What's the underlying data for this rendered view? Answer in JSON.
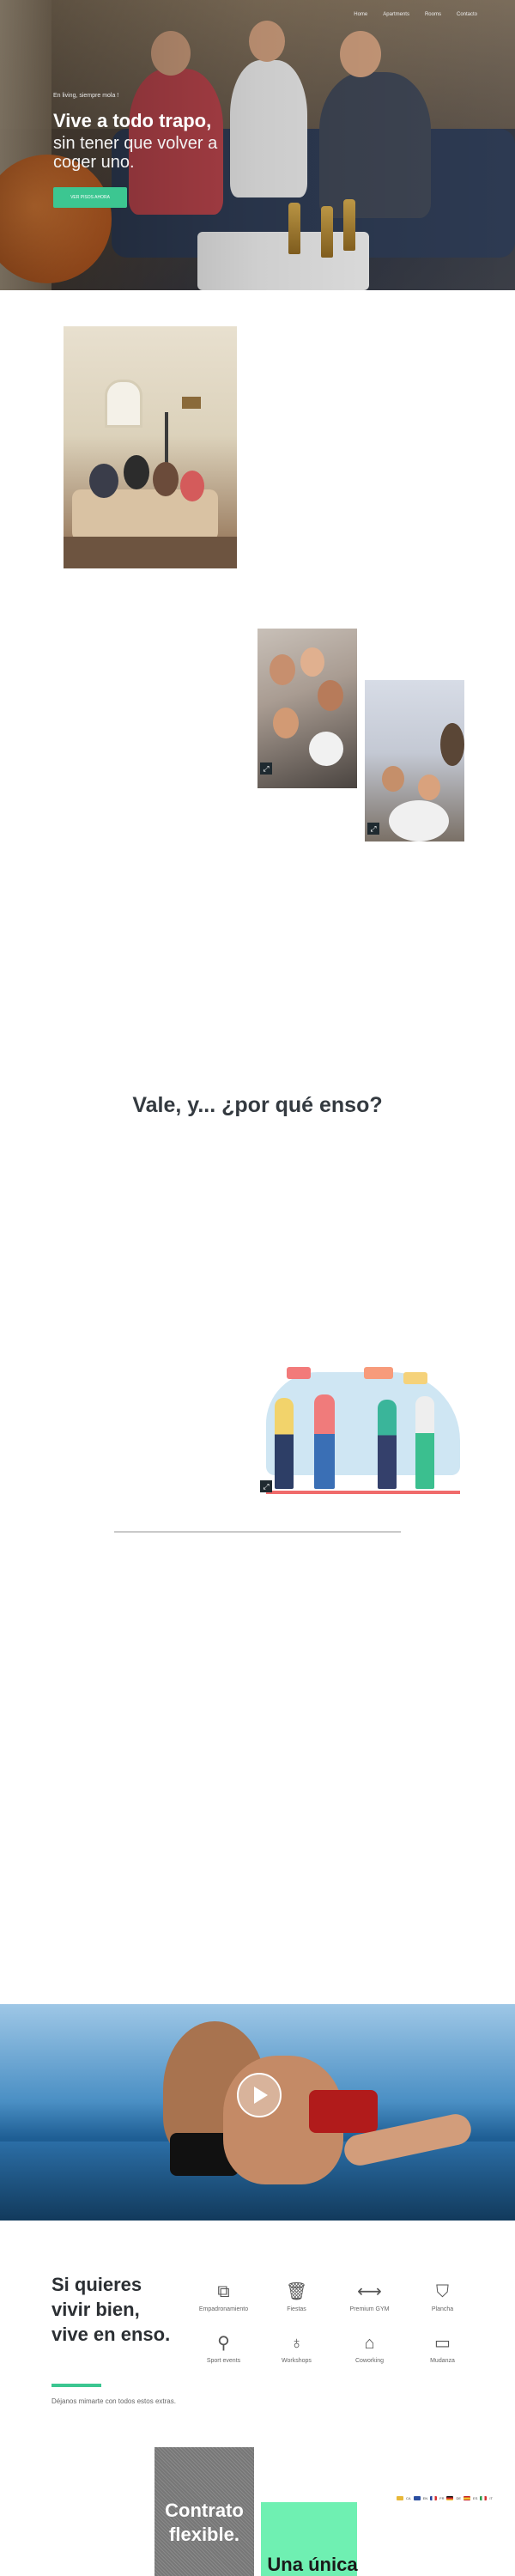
{
  "nav": {
    "items": [
      "Home",
      "Apartments",
      "Rooms",
      "Contacto"
    ]
  },
  "hero": {
    "eyebrow": "En living, siempre mola !",
    "title": "Vive a todo trapo,",
    "subtitle": "sin tener que volver a coger uno.",
    "cta_label": "VER PISOS AHORA",
    "cta_color": "#3cc691"
  },
  "why": {
    "heading": "Vale, y... ¿por qué enso?"
  },
  "features": {
    "title": "Si quieres vivir bien, vive en enso.",
    "subtitle": "Déjanos mimarte con todos estos extras.",
    "items": [
      {
        "icon": "copy-icon",
        "label": "Empadronamiento"
      },
      {
        "icon": "trash-icon",
        "label": "Fiestas"
      },
      {
        "icon": "dumbbell-icon",
        "label": "Premium GYM"
      },
      {
        "icon": "shirt-icon",
        "label": "Plancha"
      },
      {
        "icon": "racket-icon",
        "label": "Sport events"
      },
      {
        "icon": "microphone-icon",
        "label": "Workshops"
      },
      {
        "icon": "desk-icon",
        "label": "Coworking"
      },
      {
        "icon": "briefcase-icon",
        "label": "Mudanza"
      }
    ]
  },
  "cards": {
    "card1": "Contrato flexible.",
    "card2": "Una única"
  },
  "languages": [
    "CA",
    "EN",
    "FR",
    "DE",
    "ES",
    "IT"
  ]
}
